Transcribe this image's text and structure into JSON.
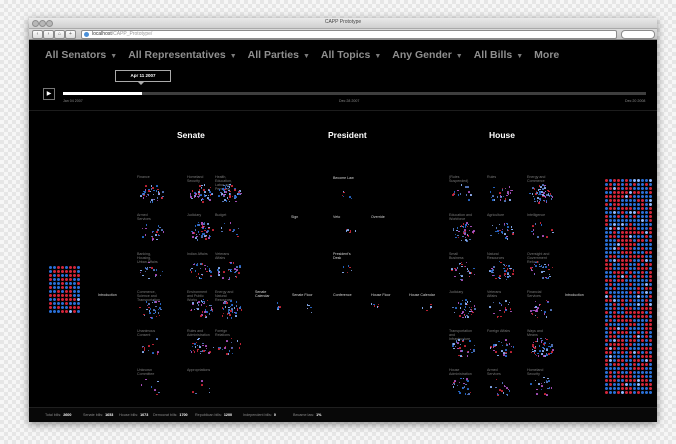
{
  "window": {
    "title": "CAPP Prototype"
  },
  "browser": {
    "url_host": "localhost",
    "url_path": "/CAPP_Prototype/"
  },
  "nav": [
    {
      "label": "All Senators",
      "dropdown": true
    },
    {
      "label": "All Representatives",
      "dropdown": true
    },
    {
      "label": "All Parties",
      "dropdown": true
    },
    {
      "label": "All Topics",
      "dropdown": true
    },
    {
      "label": "Any Gender",
      "dropdown": true
    },
    {
      "label": "All Bills",
      "dropdown": true
    },
    {
      "label": "More",
      "dropdown": false
    }
  ],
  "timeline": {
    "start": "Jan 04 2007",
    "middle": "Dec 28 2007",
    "end": "Dec 20 2008",
    "current": "Apr 11 2007",
    "progress": 0.135
  },
  "sections": {
    "senate": "Senate",
    "president": "President",
    "house": "House"
  },
  "stages": {
    "introduction_left": "Introduction",
    "senate_calendar": "Senate Calendar",
    "senate_floor": "Senate Floor",
    "conference": "Conference",
    "house_floor": "House Floor",
    "house_calendar": "House Calendar",
    "introduction_right": "Introduction",
    "sign": "Sign",
    "veto": "Veto",
    "override": "Override",
    "become_law": "Become Law",
    "presidents_desk": "President's Desk"
  },
  "senate_committees": [
    "Finance",
    "Homeland Security",
    "Health, Education, Labor and Pensions",
    "Armed Services",
    "Judiciary",
    "Budget",
    "Banking, Housing, Urban Affairs",
    "Indian Affairs",
    "Veterans Affairs",
    "Commerce, Science and Transportation",
    "Environment and Public Works",
    "Energy and Natural Resources",
    "Unanimous Consent",
    "Rules and Administration",
    "Foreign Relations",
    "Unknown Committee",
    "Appropriations"
  ],
  "house_committees": [
    "(Rules Suspended)",
    "Rules",
    "Energy and Commerce",
    "Education and Workforce",
    "Agriculture",
    "Intelligence",
    "Small Business",
    "Natural Resources",
    "Oversight and Government Reform",
    "Judiciary",
    "Veterans Affairs",
    "Financial Services",
    "Transportation and Infrastructure",
    "Foreign Affairs",
    "Ways and Means",
    "House Administration",
    "Armed Services",
    "Homeland Security"
  ],
  "stats": [
    {
      "label": "Total bills:",
      "value": "2600"
    },
    {
      "label": "Senate bills:",
      "value": "1653"
    },
    {
      "label": "House bills:",
      "value": "1073"
    },
    {
      "label": "Democrat bills:",
      "value": "1700"
    },
    {
      "label": "Republican bills:",
      "value": "1200"
    },
    {
      "label": "Independent bills:",
      "value": "0"
    },
    {
      "label": "Became law:",
      "value": "1%"
    }
  ],
  "colors": {
    "democrat": "#2a6fd6",
    "republican": "#d2263a",
    "other": "#8fb8ff",
    "accent": "#ffffff"
  }
}
